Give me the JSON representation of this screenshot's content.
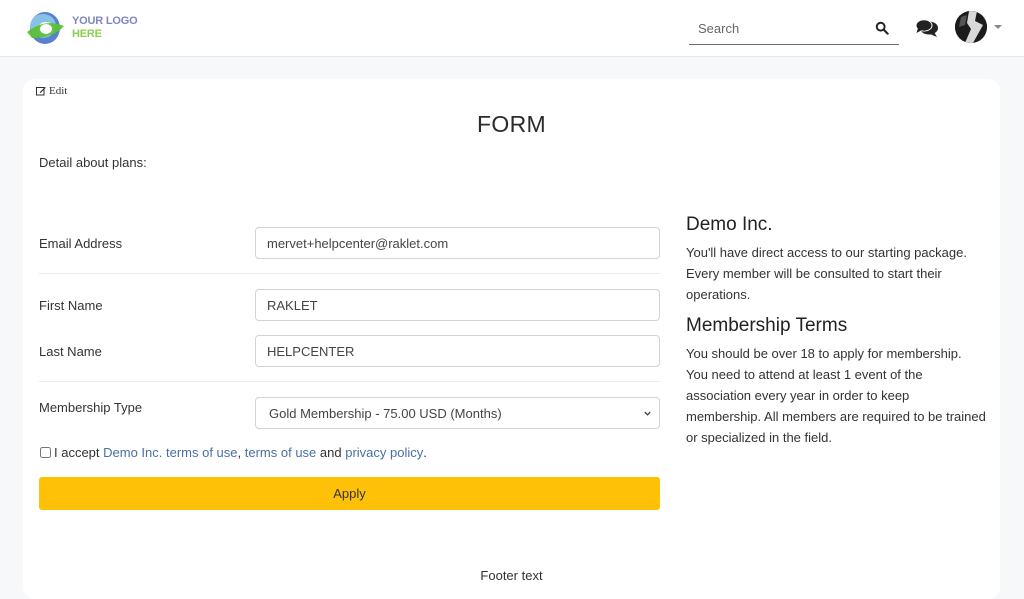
{
  "header": {
    "logo": {
      "line1": "YOUR LOGO",
      "line2": "HERE"
    },
    "search": {
      "placeholder": "Search",
      "value": ""
    },
    "icons": {
      "search": "search-icon",
      "chat": "comments-icon",
      "avatar": "user-avatar",
      "menu": "caret-down-icon"
    }
  },
  "page": {
    "edit_label": "Edit",
    "title": "FORM",
    "detail": "Detail about plans:"
  },
  "form": {
    "email": {
      "label": "Email Address",
      "value": "mervet+helpcenter@raklet.com"
    },
    "first_name": {
      "label": "First Name",
      "value": "RAKLET"
    },
    "last_name": {
      "label": "Last Name",
      "value": "HELPCENTER"
    },
    "membership_type": {
      "label": "Membership Type",
      "selected": "Gold Membership - 75.00 USD (Months)"
    },
    "accept": {
      "checked": false,
      "prefix": "I accept ",
      "link1": "Demo Inc. terms of use",
      "sep": ", ",
      "link2": "terms of use",
      "and": " and ",
      "link3": "privacy policy",
      "suffix": "."
    },
    "apply_label": "Apply"
  },
  "sidebar": {
    "org_title": "Demo Inc.",
    "org_text": "You'll have direct access to our starting package. Every member will be consulted to start their operations.",
    "terms_title": "Membership Terms",
    "terms_text": "You should be over 18 to apply for membership. You need to attend at least 1 event of the association every year in order to keep membership. All members are required to be trained or specialized in the field."
  },
  "footer": {
    "text": "Footer text"
  },
  "colors": {
    "accent": "#ffc107",
    "link": "#4a6fa5",
    "background": "#f7f8fa"
  }
}
